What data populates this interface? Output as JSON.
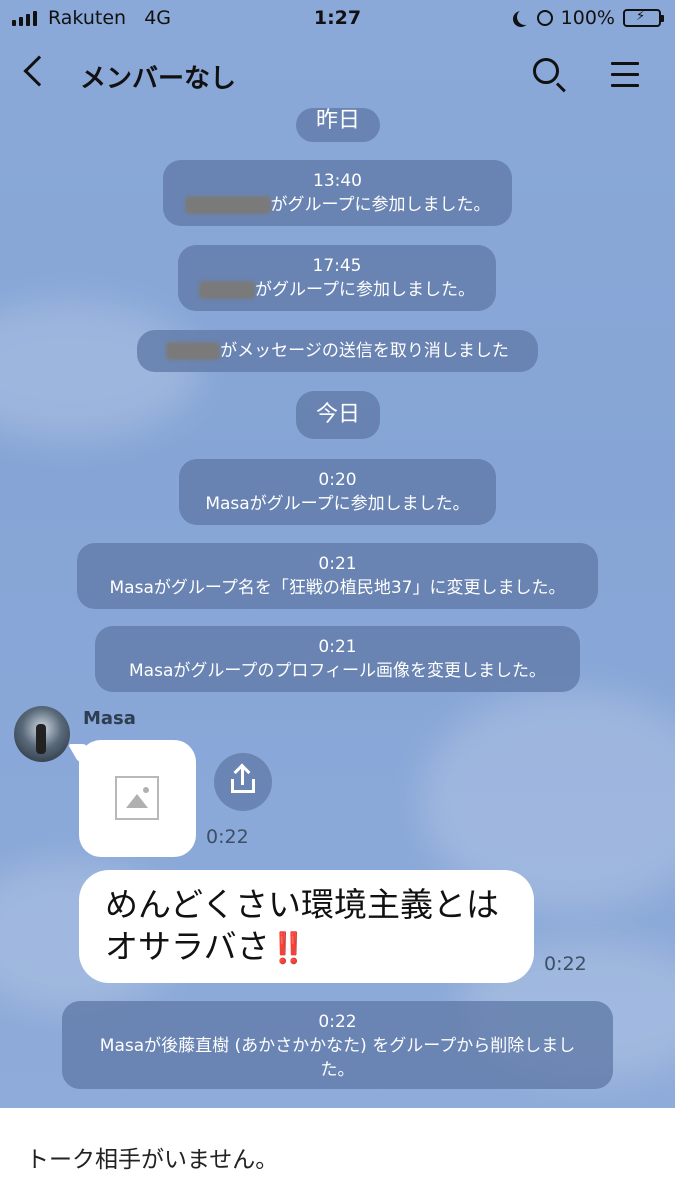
{
  "status_bar": {
    "carrier": "Rakuten",
    "network": "4G",
    "time": "1:27",
    "battery": "100%"
  },
  "header": {
    "title": "メンバーなし"
  },
  "chat": {
    "date_yesterday": "昨日",
    "events_yesterday": [
      {
        "time": "13:40",
        "text": "がグループに参加しました。"
      },
      {
        "time": "17:45",
        "text": "がグループに参加しました。"
      },
      {
        "time": "",
        "text": "がメッセージの送信を取り消しました"
      }
    ],
    "date_today": "今日",
    "events_today": [
      {
        "time": "0:20",
        "text": "Masaがグループに参加しました。"
      },
      {
        "time": "0:21",
        "text": "Masaがグループ名を「狂戦の植民地37」に変更しました。"
      },
      {
        "time": "0:21",
        "text": "Masaがグループのプロフィール画像を変更しました。"
      }
    ],
    "message": {
      "sender": "Masa",
      "image_time": "0:22",
      "text_line1": "めんどくさい環境主義とは",
      "text_line2": "オサラバさ",
      "emoji": "‼️",
      "text_time": "0:22"
    },
    "last_event": {
      "time": "0:22",
      "line1": "Masaが後藤直樹 (あかさかかなた) をグループから削除しまし",
      "line2": "た。"
    }
  },
  "footer": {
    "notice": "トーク相手がいません。"
  }
}
